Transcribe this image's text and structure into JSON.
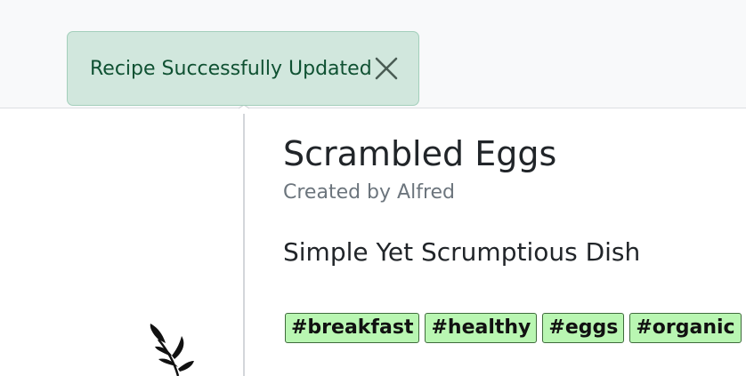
{
  "toast": {
    "message": "Recipe Successfully Updated",
    "close_icon": "close-icon",
    "colors": {
      "background": "#d1e7dd",
      "border": "#a3cfbb",
      "text": "#0f5132"
    }
  },
  "recipe": {
    "title": "Scrambled Eggs",
    "author": "Created by Alfred",
    "subtitle": "Simple Yet Scrumptious Dish",
    "tags": [
      "#breakfast",
      "#healthy",
      "#eggs",
      "#organic"
    ],
    "tag_color": "#b9f6b2"
  },
  "decor": {
    "plant_icon": "leaf-branch-icon"
  }
}
